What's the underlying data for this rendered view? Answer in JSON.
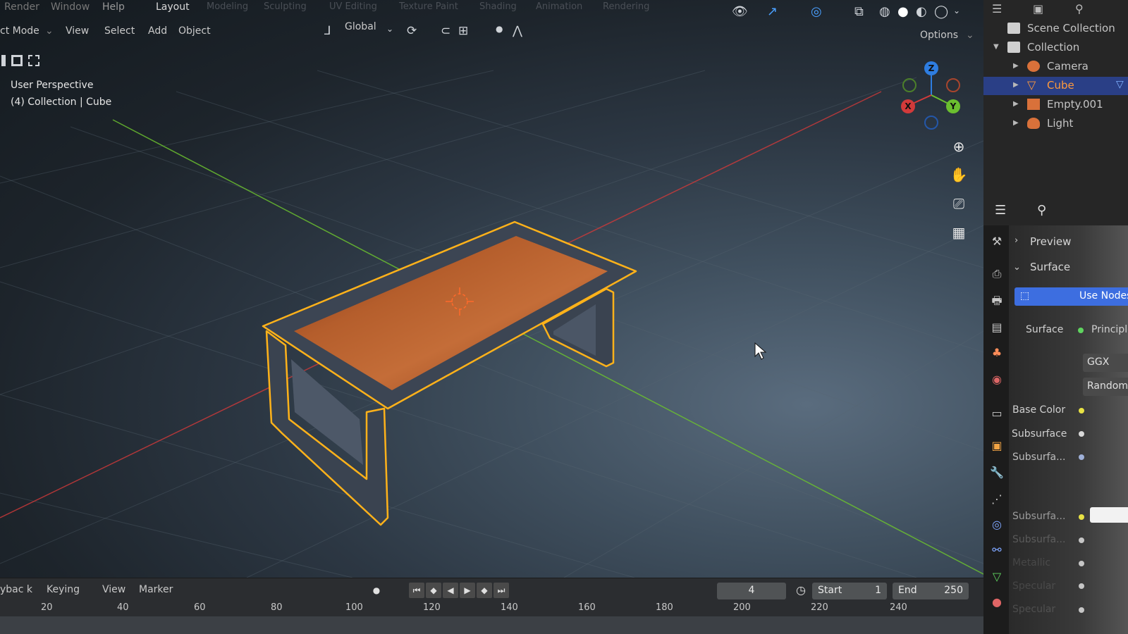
{
  "topbar": {
    "menus": [
      "Render",
      "Window",
      "Help"
    ],
    "workspace_tabs": [
      "Layout",
      "Modeling",
      "Sculpting",
      "UV Editing",
      "Texture Paint",
      "Shading",
      "Animation",
      "Rendering"
    ],
    "active_tab": "Layout"
  },
  "viewport_header": {
    "mode": "ct Mode",
    "menus": [
      "View",
      "Select",
      "Add",
      "Object"
    ],
    "orientation": "Global",
    "options_label": "Options"
  },
  "viewport": {
    "view_name": "User Perspective",
    "collection_info": "(4) Collection | Cube",
    "gizmo": {
      "z": "Z",
      "y": "Y",
      "x": "X"
    },
    "colors": {
      "x_axis": "#d23a3a",
      "y_axis": "#6bbf2f",
      "z_axis": "#2e7de0",
      "selection_outline": "#ffb21a",
      "wood": "#b0592a"
    }
  },
  "outliner": {
    "scene_collection": "Scene Collection",
    "collection": "Collection",
    "items": [
      {
        "label": "Camera",
        "icon": "camera-icon",
        "selected": false
      },
      {
        "label": "Cube",
        "icon": "mesh-icon",
        "selected": true
      },
      {
        "label": "Empty.001",
        "icon": "image-empty-icon",
        "selected": false
      },
      {
        "label": "Light",
        "icon": "light-icon",
        "selected": false
      }
    ]
  },
  "properties": {
    "preview": "Preview",
    "surface_section": "Surface",
    "use_nodes": "Use Nodes",
    "surface_label": "Surface",
    "surface_value": "Principled BSDF",
    "distribution": "GGX",
    "subsurface_method": "Random Walk",
    "base_color_label": "Base Color",
    "subsurface_label": "Subsurface",
    "subsurface_radius_label": "Subsurfa...",
    "faded_labels": [
      "Subsurfa...",
      "Subsurfa...",
      "Metallic",
      "Specular",
      "Specular"
    ]
  },
  "timeline": {
    "menus": [
      "ybac k",
      "Keying",
      "View",
      "Marker"
    ],
    "current_frame": "4",
    "start_label": "Start",
    "start_value": "1",
    "end_label": "End",
    "end_value": "250",
    "ticks": [
      "20",
      "40",
      "60",
      "80",
      "100",
      "120",
      "140",
      "160",
      "180",
      "200",
      "220",
      "240"
    ]
  }
}
